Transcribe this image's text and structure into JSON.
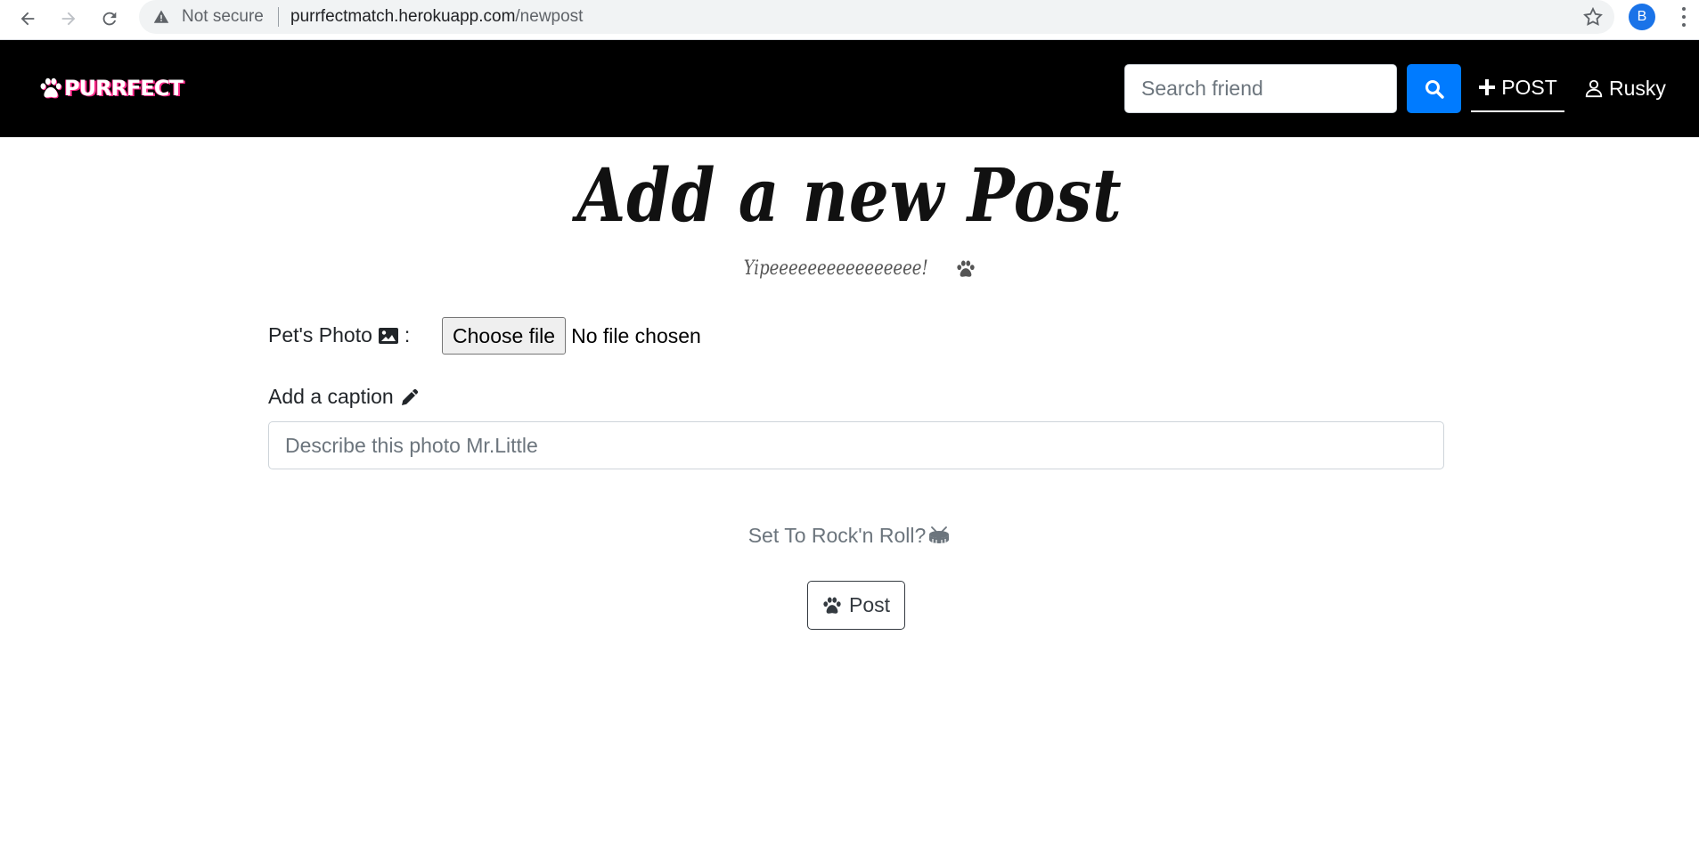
{
  "browser": {
    "security_label": "Not secure",
    "url_host": "purrfectmatch.herokuapp.com",
    "url_path": "/newpost",
    "profile_initial": "B"
  },
  "navbar": {
    "brand": "PURRFECT",
    "search_placeholder": "Search friend",
    "post_label": "POST",
    "user_label": "Rusky"
  },
  "main": {
    "title": "Add a new Post",
    "subtitle": "Yipeeeeeeeeeeeeeeee!",
    "photo_label": "Pet's Photo",
    "photo_label_suffix": ":",
    "file_button": "Choose file",
    "file_status": "No file chosen",
    "caption_label": "Add a caption",
    "caption_placeholder": "Describe this photo Mr.Little",
    "rock_text": "Set To Rock'n Roll?",
    "post_button": "Post"
  },
  "colors": {
    "navbar_bg": "#000000",
    "search_button": "#007bff",
    "brand_shadow": "#ff2a8a"
  },
  "icons": [
    "back-arrow-icon",
    "forward-arrow-icon",
    "reload-icon",
    "warning-icon",
    "star-icon",
    "paw-icon",
    "search-icon",
    "plus-icon",
    "user-icon",
    "image-icon",
    "pencil-icon",
    "drum-icon"
  ]
}
